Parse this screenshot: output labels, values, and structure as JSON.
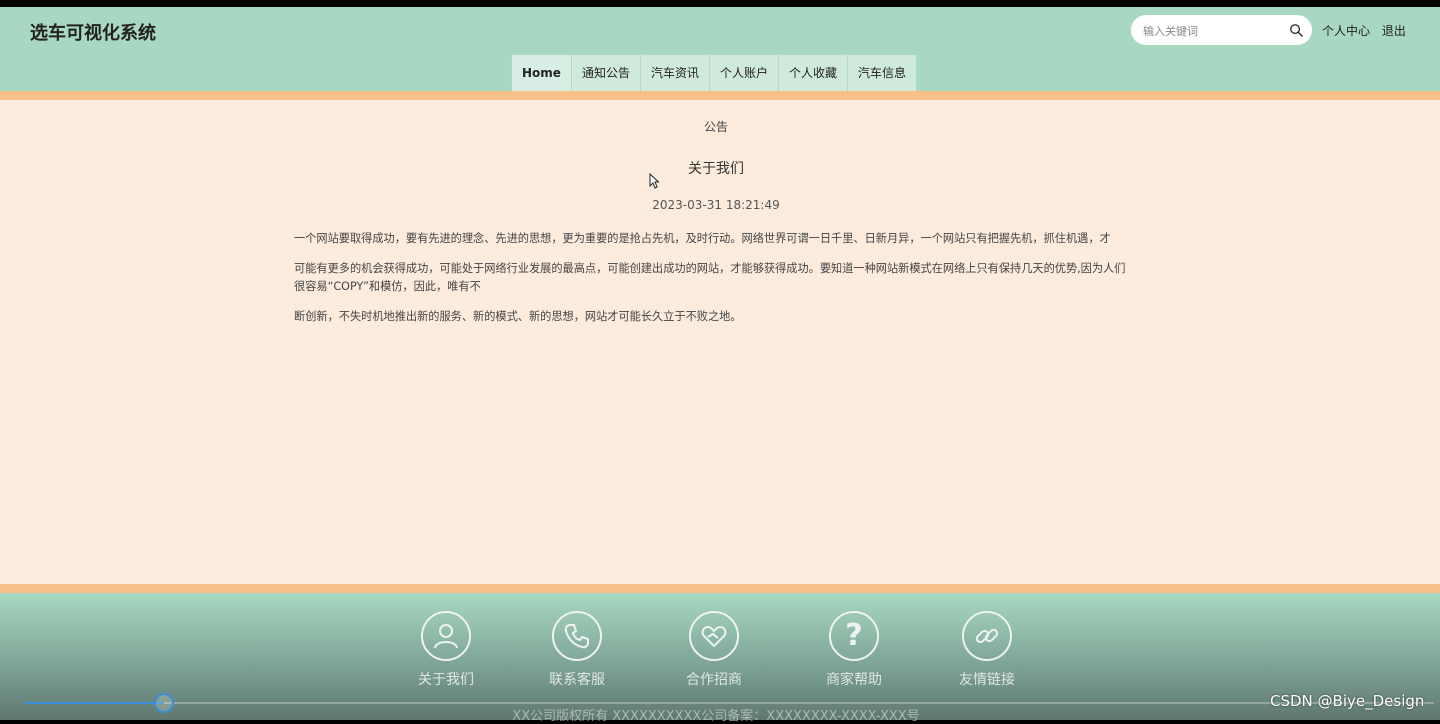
{
  "header": {
    "site_title": "选车可视化系统",
    "search_placeholder": "输入关键词",
    "user_center_label": "个人中心",
    "logout_label": "退出"
  },
  "nav": {
    "items": [
      {
        "label": "Home",
        "active": true
      },
      {
        "label": "通知公告",
        "active": false
      },
      {
        "label": "汽车资讯",
        "active": false
      },
      {
        "label": "个人账户",
        "active": false
      },
      {
        "label": "个人收藏",
        "active": false
      },
      {
        "label": "汽车信息",
        "active": false
      }
    ]
  },
  "article": {
    "section_label": "公告",
    "title": "关于我们",
    "date": "2023-03-31 18:21:49",
    "paragraphs": [
      "一个网站要取得成功，要有先进的理念、先进的思想，更为重要的是抢占先机，及时行动。网络世界可谓一日千里、日新月异，一个网站只有把握先机，抓住机遇，才",
      "可能有更多的机会获得成功，可能处于网络行业发展的最高点，可能创建出成功的网站，才能够获得成功。要知道一种网站新模式在网络上只有保持几天的优势,因为人们很容易“COPY”和模仿，因此，唯有不",
      "断创新，不失时机地推出新的服务、新的模式、新的思想，网站才可能长久立于不败之地。"
    ]
  },
  "footer": {
    "items": [
      {
        "label": "关于我们",
        "icon": "user-icon"
      },
      {
        "label": "联系客服",
        "icon": "phone-icon"
      },
      {
        "label": "合作招商",
        "icon": "handshake-icon"
      },
      {
        "label": "商家帮助",
        "icon": "help-icon"
      },
      {
        "label": "友情链接",
        "icon": "link-icon"
      }
    ],
    "copyright": "XX公司版权所有 XXXXXXXXXX公司备案：XXXXXXXX-XXXX-XXX号"
  },
  "video_player": {
    "progress_fraction": 0.099
  },
  "watermark": "CSDN @Biye_Design",
  "colors": {
    "header_bg": "#a8d8c2",
    "accent_bar": "#f6c088",
    "content_bg": "#fdebdd",
    "progress": "#3a8fd6"
  }
}
